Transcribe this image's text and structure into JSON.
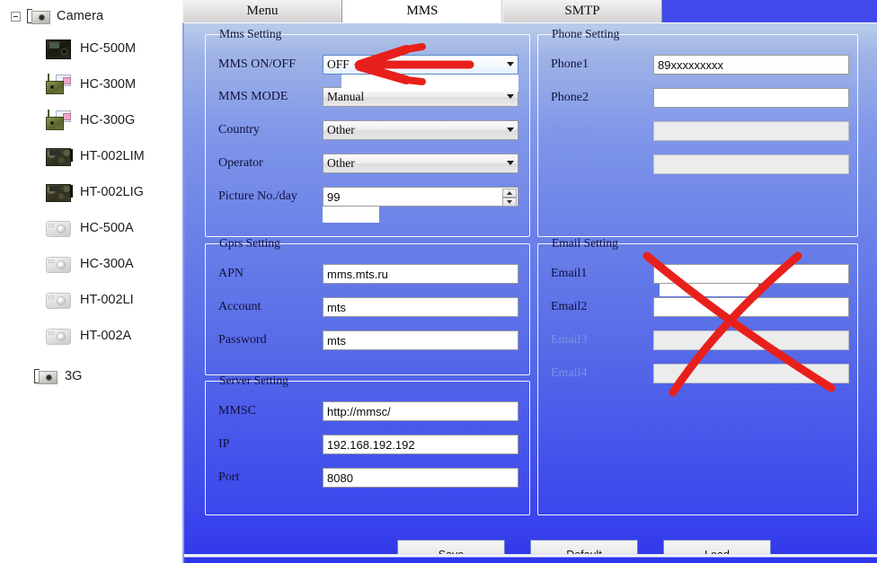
{
  "sidebar": {
    "root": {
      "label": "Camera",
      "icon": "camera-tree-icon",
      "expander": "collapse-box"
    },
    "items": [
      {
        "label": "HC-500M",
        "icon": "camera-device-icon",
        "style": "dark"
      },
      {
        "label": "HC-300M",
        "icon": "camera-device-icon",
        "style": "green"
      },
      {
        "label": "HC-300G",
        "icon": "camera-device-icon",
        "style": "green"
      },
      {
        "label": "HT-002LIM",
        "icon": "camera-device-icon",
        "style": "camo"
      },
      {
        "label": "HT-002LIG",
        "icon": "camera-device-icon",
        "style": "camo"
      },
      {
        "label": "HC-500A",
        "icon": "camera-device-icon",
        "style": "grey"
      },
      {
        "label": "HC-300A",
        "icon": "camera-device-icon",
        "style": "grey"
      },
      {
        "label": "HT-002LI",
        "icon": "camera-device-icon",
        "style": "grey"
      },
      {
        "label": "HT-002A",
        "icon": "camera-device-icon",
        "style": "grey"
      }
    ],
    "leaf": {
      "label": "3G",
      "icon": "camera-tree-icon"
    }
  },
  "tabs": [
    {
      "label": "Menu",
      "active": false
    },
    {
      "label": "MMS",
      "active": true
    },
    {
      "label": "SMTP",
      "active": false
    }
  ],
  "mms_setting": {
    "title": "Mms Setting",
    "rows": [
      {
        "label": "MMS ON/OFF",
        "value": "OFF",
        "type": "combo",
        "focused": true,
        "disabled": false
      },
      {
        "label": "MMS MODE",
        "value": "Manual",
        "type": "combo",
        "focused": false,
        "disabled": false
      },
      {
        "label": "Country",
        "value": "Other",
        "type": "combo",
        "focused": false,
        "disabled": false
      },
      {
        "label": "Operator",
        "value": "Other",
        "type": "combo",
        "focused": false,
        "disabled": false
      },
      {
        "label": "Picture No./day",
        "value": "99",
        "type": "spinner",
        "focused": false,
        "disabled": false
      }
    ]
  },
  "phone_setting": {
    "title": "Phone Setting",
    "rows": [
      {
        "label": "Phone1",
        "value": "89xxxxxxxxx",
        "disabled": false
      },
      {
        "label": "Phone2",
        "value": "",
        "disabled": false
      },
      {
        "label": "Phone3",
        "value": "",
        "disabled": true
      },
      {
        "label": "Phone4",
        "value": "",
        "disabled": true
      }
    ]
  },
  "gprs_setting": {
    "title": "Gprs Setting",
    "rows": [
      {
        "label": "APN",
        "value": "mms.mts.ru",
        "disabled": false
      },
      {
        "label": "Account",
        "value": "mts",
        "disabled": false
      },
      {
        "label": "Password",
        "value": "mts",
        "disabled": false
      }
    ]
  },
  "email_setting": {
    "title": "Email Setting",
    "rows": [
      {
        "label": "Email1",
        "value": "",
        "disabled": false
      },
      {
        "label": "Email2",
        "value": "",
        "disabled": false
      },
      {
        "label": "Email3",
        "value": "",
        "disabled": true
      },
      {
        "label": "Email4",
        "value": "",
        "disabled": true
      }
    ]
  },
  "server_setting": {
    "title": "Server Setting",
    "rows": [
      {
        "label": "MMSC",
        "value": "http://mmsc/",
        "disabled": false
      },
      {
        "label": "IP",
        "value": "192.168.192.192",
        "disabled": false
      },
      {
        "label": "Port",
        "value": "8080",
        "disabled": false
      }
    ]
  },
  "buttons": {
    "save": "Save",
    "default": "Default",
    "load": "Load"
  },
  "annotations": {
    "arrow": {
      "name": "red-arrow-annotation",
      "color": "#e8201c",
      "points_to": "MMS ON/OFF"
    },
    "cross": {
      "name": "red-cross-annotation",
      "color": "#e8201c",
      "covers": "Email Setting"
    }
  },
  "colors": {
    "accent_blue": "#4149ec",
    "panel_top": "#b9cde9",
    "panel_bottom": "#2f36ea",
    "annotation_red": "#e8201c",
    "disabled_label": "#7f92e1"
  }
}
